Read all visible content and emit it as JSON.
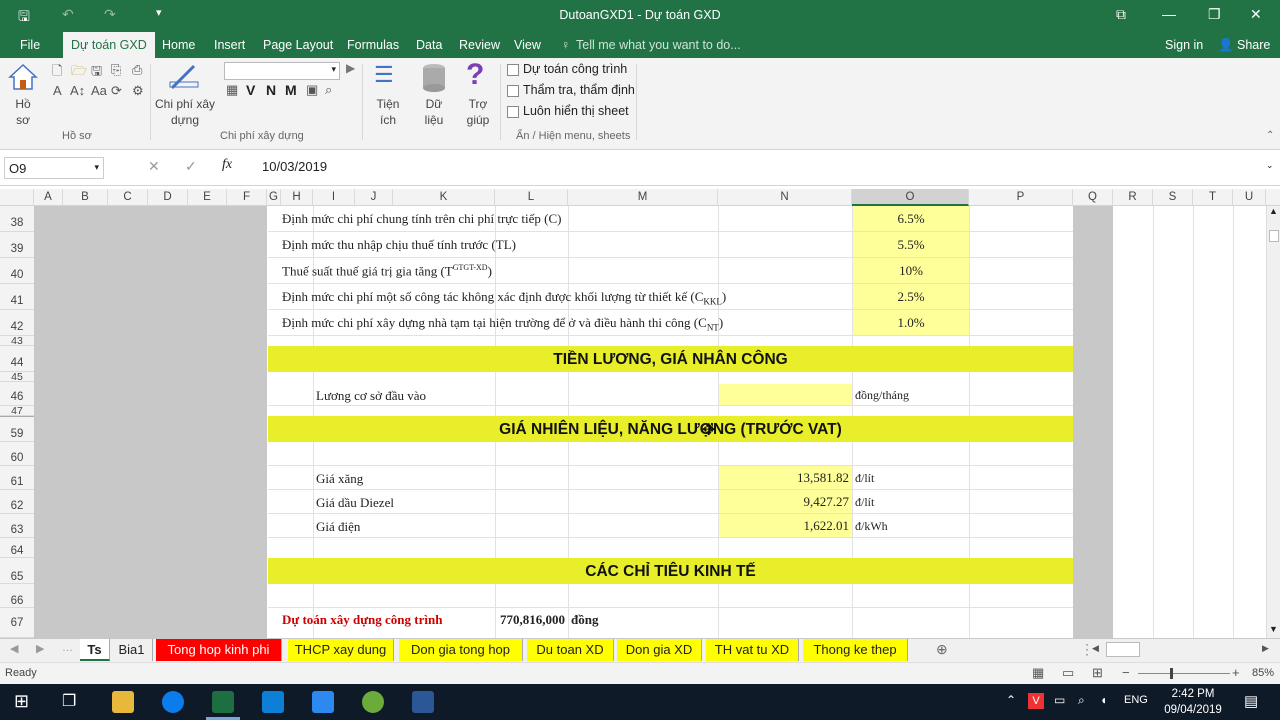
{
  "window": {
    "title": "DutoanGXD1 - Dự toán GXD"
  },
  "menubar": {
    "tabs": [
      "File",
      "Dự toán GXD",
      "Home",
      "Insert",
      "Page Layout",
      "Formulas",
      "Data",
      "Review",
      "View"
    ],
    "tell": "Tell me what you want to do...",
    "signin": "Sign in",
    "share": "Share"
  },
  "ribbon": {
    "ho_so": "Hồ sơ",
    "ho_so_btn": "Hồ sơ",
    "chi_phi": "Chi phí xây dựng",
    "chi_phi_btn": "Chi phí xây dựng",
    "tien_ich": "Tiện ích",
    "du_lieu": "Dữ liệu",
    "tro_giup": "Trợ giúp",
    "checks": [
      "Dự toán công trình",
      "Thẩm tra, thẩm định",
      "Luôn hiển thị sheet"
    ],
    "group3": "Ẩn / Hiện menu, sheets",
    "font_letters": [
      "V",
      "N",
      "M"
    ]
  },
  "formula": {
    "namebox": "O9",
    "value": "10/03/2019",
    "fx": "fx"
  },
  "columns": [
    "A",
    "B",
    "C",
    "D",
    "E",
    "F",
    "G",
    "H",
    "I",
    "J",
    "K",
    "L",
    "M",
    "N",
    "O",
    "P",
    "Q",
    "R",
    "S",
    "T",
    "U"
  ],
  "rows": {
    "r38": {
      "num": "38",
      "text": "Định mức chi phí chung tính trên chi phí trực tiếp (C)",
      "val": "6.5%"
    },
    "r39": {
      "num": "39",
      "text": "Định mức thu nhập chịu thuế tính trước (TL)",
      "val": "5.5%"
    },
    "r40": {
      "num": "40",
      "text": "Thuế suất thuế giá trị gia tăng (T",
      "sup": "GTGT-XD",
      "tail": ")",
      "val": "10%"
    },
    "r41": {
      "num": "41",
      "text": "Định mức chi phí một số công tác không xác định được khối lượng từ thiết kế (C",
      "sub": "KKL",
      "tail": ")",
      "val": "2.5%"
    },
    "r42": {
      "num": "42",
      "text": "Định mức chi phí xây dựng nhà tạm tại hiện trường để ở và điều hành thi công (C",
      "sub": "NT",
      "tail": ")",
      "val": "1.0%"
    },
    "r43": {
      "num": "43"
    },
    "r44": {
      "num": "44",
      "band": "TIỀN LƯƠNG, GIÁ NHÂN CÔNG"
    },
    "r45": {
      "num": "45"
    },
    "r46": {
      "num": "46",
      "label": "Lương cơ sở đầu vào",
      "unit": "đồng/tháng"
    },
    "r47": {
      "num": "47"
    },
    "r59": {
      "num": "59",
      "band": "GIÁ NHIÊN LIỆU, NĂNG LƯỢNG (TRƯỚC VAT)"
    },
    "r60": {
      "num": "60"
    },
    "r61": {
      "num": "61",
      "label": "Giá xăng",
      "value": "13,581.82",
      "unit": "đ/lít"
    },
    "r62": {
      "num": "62",
      "label": "Giá dầu Diezel",
      "value": "9,427.27",
      "unit": "đ/lít"
    },
    "r63": {
      "num": "63",
      "label": "Giá điện",
      "value": "1,622.01",
      "unit": "đ/kWh"
    },
    "r64": {
      "num": "64"
    },
    "r65": {
      "num": "65",
      "band": "CÁC CHỈ TIÊU KINH TẾ"
    },
    "r66": {
      "num": "66"
    },
    "r67": {
      "num": "67",
      "label": "Dự toán xây dựng công trình",
      "value": "770,816,000",
      "unit": "đồng"
    }
  },
  "sheets": [
    {
      "name": "Ts",
      "color": "#ffffff"
    },
    {
      "name": "Bia1",
      "color": "#f0f0f0"
    },
    {
      "name": "Tong hop kinh phi",
      "color": "#ff0000"
    },
    {
      "name": "THCP xay dung",
      "color": "#ffff00"
    },
    {
      "name": "Don gia tong hop",
      "color": "#ffff00"
    },
    {
      "name": "Du toan XD",
      "color": "#ffff00"
    },
    {
      "name": "Don gia XD",
      "color": "#ffff00"
    },
    {
      "name": "TH vat tu XD",
      "color": "#ffff00"
    },
    {
      "name": "Thong ke thep",
      "color": "#ffff00"
    }
  ],
  "status": {
    "ready": "Ready",
    "zoom": "85%"
  },
  "taskbar": {
    "lang": "ENG",
    "time": "2:42 PM",
    "date": "09/04/2019"
  }
}
